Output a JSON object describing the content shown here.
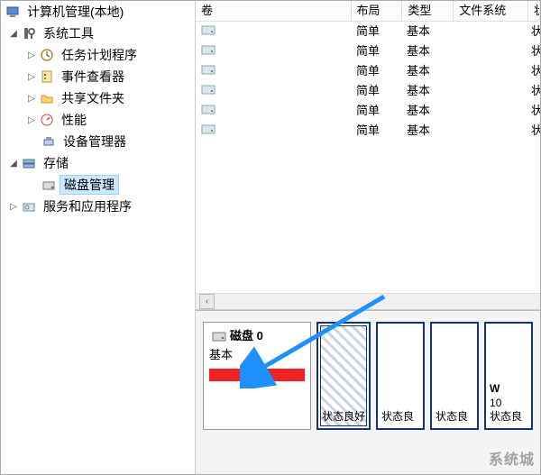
{
  "tree": {
    "root": "计算机管理(本地)",
    "sys_tools": "系统工具",
    "task_sched": "任务计划程序",
    "event_viewer": "事件查看器",
    "shared": "共享文件夹",
    "perf": "性能",
    "devmgr": "设备管理器",
    "storage": "存储",
    "diskmgmt": "磁盘管理",
    "services": "服务和应用程序"
  },
  "columns": {
    "vol": "卷",
    "layout": "布局",
    "type": "类型",
    "fs": "文件系统",
    "status": "状态"
  },
  "volumes": [
    {
      "layout": "简单",
      "type": "基本",
      "status": "状态良"
    },
    {
      "layout": "简单",
      "type": "基本",
      "status": "状态良"
    },
    {
      "layout": "简单",
      "type": "基本",
      "status": "状态良"
    },
    {
      "layout": "简单",
      "type": "基本",
      "status": "状态良"
    },
    {
      "layout": "简单",
      "type": "基本",
      "status": "状态良"
    },
    {
      "layout": "简单",
      "type": "基本",
      "status": "状态良"
    }
  ],
  "disk": {
    "title": "磁盘 0",
    "type": "基本"
  },
  "partitions": [
    {
      "status": "状态良好"
    },
    {
      "status": "状态良"
    },
    {
      "status": "状态良"
    },
    {
      "label1": "W",
      "label2": "10",
      "status": "状态良"
    }
  ],
  "watermark": "系统城"
}
